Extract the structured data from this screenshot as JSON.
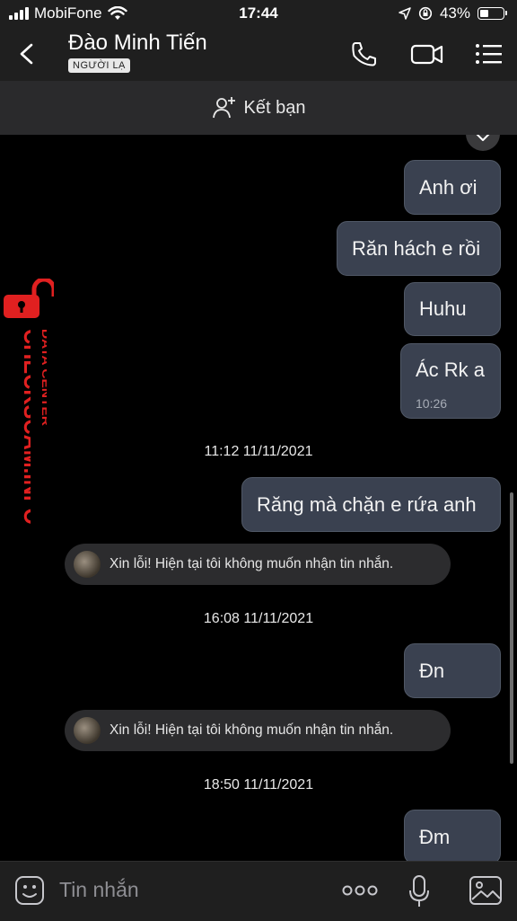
{
  "status_bar": {
    "carrier": "MobiFone",
    "time": "17:44",
    "battery_text": "43%",
    "battery_level": 0.43
  },
  "header": {
    "name": "Đào Minh Tiến",
    "tag": "NGƯỜI LẠ",
    "icons": [
      "back-icon",
      "phone-icon",
      "video-call-icon",
      "menu-icon"
    ]
  },
  "add_friend": {
    "label": "Kết bạn",
    "icon": "add-friend-icon"
  },
  "messages": {
    "m1": "Anh ơi",
    "m2": "Răn hách e rồi",
    "m3": "Huhu",
    "m4": "Ác Rk a",
    "m4_time": "10:26",
    "ts1": "11:12 11/11/2021",
    "m5": "Răng mà chặn e rứa anh",
    "sys1": "Xin lỗi! Hiện tại tôi không muốn nhận tin nhắn.",
    "ts2": "16:08 11/11/2021",
    "m6": "Đn",
    "sys2": "Xin lỗi! Hiện tại tôi không muốn nhận tin nhắn.",
    "ts3": "18:50 11/11/2021",
    "m7": "Đm"
  },
  "watermark": {
    "main": "CHECKSCAM.INFO",
    "sub": "DATA CENTER",
    "color": "#e02020"
  },
  "input": {
    "placeholder": "Tin nhắn",
    "icons": [
      "sticker-icon",
      "more-icon",
      "microphone-icon",
      "image-icon"
    ]
  },
  "colors": {
    "bubble": "#3a4150",
    "header": "#1f1f1f",
    "system_pill": "#2c2c2e"
  }
}
